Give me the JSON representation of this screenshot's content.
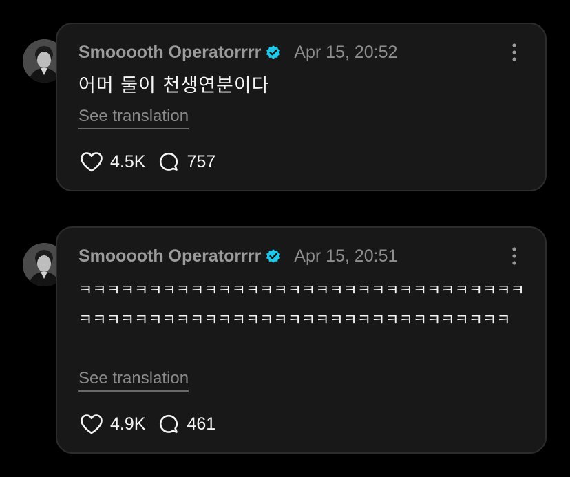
{
  "comments": [
    {
      "author": "Smooooth Operatorrrr",
      "timestamp": "Apr 15, 20:52",
      "text": "어머 둘이 천생연분이다",
      "translate_label": "See translation",
      "likes": "4.5K",
      "replies": "757"
    },
    {
      "author": "Smooooth Operatorrrr",
      "timestamp": "Apr 15, 20:51",
      "text": "ㅋㅋㅋㅋㅋㅋㅋㅋㅋㅋㅋㅋㅋㅋㅋㅋㅋㅋㅋㅋㅋㅋㅋㅋㅋㅋㅋㅋㅋㅋㅋㅋㅋㅋㅋㅋㅋㅋㅋㅋㅋㅋㅋㅋㅋㅋㅋㅋㅋㅋㅋㅋㅋㅋㅋㅋㅋㅋㅋㅋㅋㅋㅋ",
      "translate_label": "See translation",
      "likes": "4.9K",
      "replies": "461"
    }
  ],
  "icons": {
    "verified": "verified-badge-icon",
    "more": "more-vertical-icon",
    "like": "heart-icon",
    "reply": "comment-bubble-icon"
  },
  "colors": {
    "background": "#000000",
    "card": "#181818",
    "card_border": "#2c2c2c",
    "verified": "#1fc7e8",
    "muted": "#9b9b9b"
  }
}
